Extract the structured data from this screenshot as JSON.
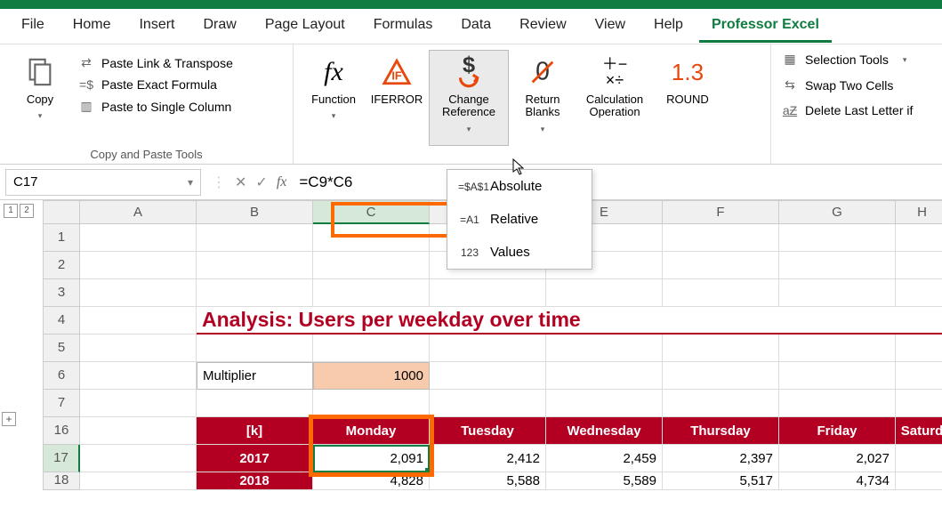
{
  "tabs": {
    "file": "File",
    "home": "Home",
    "insert": "Insert",
    "draw": "Draw",
    "pagelayout": "Page Layout",
    "formulas": "Formulas",
    "data": "Data",
    "review": "Review",
    "view": "View",
    "help": "Help",
    "professor": "Professor Excel"
  },
  "ribbon": {
    "copy": "Copy",
    "paste_group_label": "Copy and Paste Tools",
    "paste_link_transpose": "Paste Link & Transpose",
    "paste_exact": "Paste Exact Formula",
    "paste_single_col": "Paste to Single Column",
    "function": "Function",
    "iferror": "IFERROR",
    "change_reference": "Change Reference",
    "return_blanks": "Return Blanks",
    "calc_op": "Calculation Operation",
    "round": "ROUND",
    "selection_tools": "Selection Tools",
    "swap_two": "Swap Two Cells",
    "delete_last": "Delete Last Letter if"
  },
  "dropdown": {
    "absolute": "Absolute",
    "relative": "Relative",
    "values": "Values"
  },
  "name_box": "C17",
  "formula": "=C9*C6",
  "cols": [
    "A",
    "B",
    "C",
    "D",
    "E",
    "F",
    "G",
    "H"
  ],
  "rows": [
    "1",
    "2",
    "3",
    "4",
    "5",
    "6",
    "7",
    "16",
    "17",
    "18"
  ],
  "title": "Analysis: Users per weekday over time",
  "multiplier_label": "Multiplier",
  "multiplier_value": "1000",
  "headers": {
    "k": "[k]",
    "mon": "Monday",
    "tue": "Tuesday",
    "wed": "Wednesday",
    "thu": "Thursday",
    "fri": "Friday",
    "sat": "Saturd"
  },
  "data": {
    "y2017": {
      "yr": "2017",
      "mon": "2,091",
      "tue": "2,412",
      "wed": "2,459",
      "thu": "2,397",
      "fri": "2,027"
    },
    "y2018": {
      "yr": "2018",
      "mon": "4,828",
      "tue": "5,588",
      "wed": "5,589",
      "thu": "5,517",
      "fri": "4,734"
    }
  },
  "gutter": {
    "one": "1",
    "two": "2",
    "plus": "+"
  }
}
